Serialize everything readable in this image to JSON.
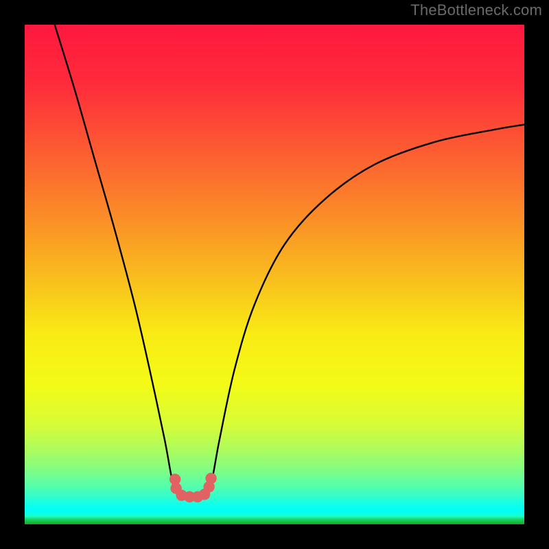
{
  "watermark": "TheBottleneck.com",
  "chart_data": {
    "type": "line",
    "title": "",
    "xlabel": "",
    "ylabel": "",
    "xlim": [
      0,
      100
    ],
    "ylim": [
      0,
      100
    ],
    "grid": false,
    "series": [
      {
        "name": "bottleneck-curve",
        "x": [
          6,
          10,
          14,
          18,
          22,
          25,
          28,
          29.5,
          30.5,
          31.5,
          32.5,
          34.5,
          35.5,
          36.5,
          37.5,
          39,
          42,
          46,
          52,
          60,
          70,
          82,
          94,
          100
        ],
        "y": [
          100,
          87,
          73,
          59,
          44,
          31,
          17,
          9,
          7,
          6,
          5.5,
          5.5,
          6,
          7,
          9,
          17,
          31,
          44,
          56,
          65,
          72,
          76.5,
          79,
          80
        ]
      }
    ],
    "markers": [
      {
        "x": 30.1,
        "y": 9.0
      },
      {
        "x": 30.3,
        "y": 7.2
      },
      {
        "x": 31.4,
        "y": 5.8
      },
      {
        "x": 33.0,
        "y": 5.5
      },
      {
        "x": 34.6,
        "y": 5.5
      },
      {
        "x": 36.0,
        "y": 6.0
      },
      {
        "x": 36.9,
        "y": 7.5
      },
      {
        "x": 37.3,
        "y": 9.2
      }
    ],
    "gradient_stops": [
      {
        "offset": 0,
        "color": "#fe183e"
      },
      {
        "offset": 12,
        "color": "#fe2c3b"
      },
      {
        "offset": 25,
        "color": "#fd5b32"
      },
      {
        "offset": 38,
        "color": "#fb8b28"
      },
      {
        "offset": 50,
        "color": "#f9bb1e"
      },
      {
        "offset": 62,
        "color": "#f9eb15"
      },
      {
        "offset": 72,
        "color": "#f3fb16"
      },
      {
        "offset": 80,
        "color": "#d7fc37"
      },
      {
        "offset": 85,
        "color": "#adfc5c"
      },
      {
        "offset": 89,
        "color": "#83fd82"
      },
      {
        "offset": 92,
        "color": "#5afea7"
      },
      {
        "offset": 94.5,
        "color": "#30fecd"
      },
      {
        "offset": 96.5,
        "color": "#07fff2"
      },
      {
        "offset": 97.8,
        "color": "#07fff2"
      },
      {
        "offset": 98.4,
        "color": "#20febc"
      },
      {
        "offset": 99.0,
        "color": "#1bd46b"
      },
      {
        "offset": 100,
        "color": "#15a91a"
      }
    ],
    "marker_color": "#e06262",
    "curve_color": "#000000"
  }
}
